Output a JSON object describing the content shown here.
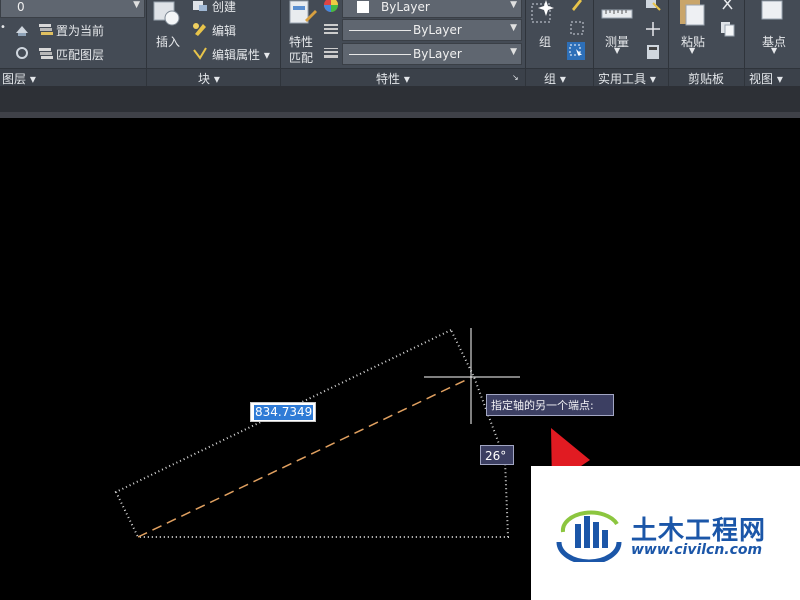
{
  "ribbon": {
    "layer_combo_value": "0",
    "layer": {
      "set_current": "置为当前",
      "match_layer": "匹配图层",
      "panel_title": "图层 ▾"
    },
    "block": {
      "insert": "插入",
      "create": "创建",
      "edit": "编辑",
      "edit_attributes": "编辑属性 ▾",
      "panel_title": "块 ▾"
    },
    "properties": {
      "match_props_line1": "特性",
      "match_props_line2": "匹配",
      "color_combo": "ByLayer",
      "linetype_combo": "ByLayer",
      "lineweight_combo": "ByLayer",
      "panel_title": "特性 ▾"
    },
    "groups": {
      "group": "组",
      "panel_title": "组 ▾"
    },
    "utilities": {
      "measure": "测量",
      "panel_title": "实用工具 ▾"
    },
    "clipboard": {
      "paste": "粘贴",
      "panel_title": "剪贴板"
    },
    "view": {
      "base_point": "基点",
      "panel_title": "视图 ▾"
    }
  },
  "canvas": {
    "dimension_input_value": "834.7349",
    "prompt_tooltip": "指定轴的另一个端点:",
    "angle_label": "26°"
  },
  "watermark": {
    "title": "土木工程网",
    "url": "www.civilcn.com"
  },
  "colors": {
    "ribbon_bg": "#444b55",
    "canvas_bg": "#000000",
    "dashed_axis": "#e0a060",
    "tooltip_bg": "#3c3f62",
    "watermark_blue": "#1b56a8",
    "arrow_red": "#e11b22"
  }
}
